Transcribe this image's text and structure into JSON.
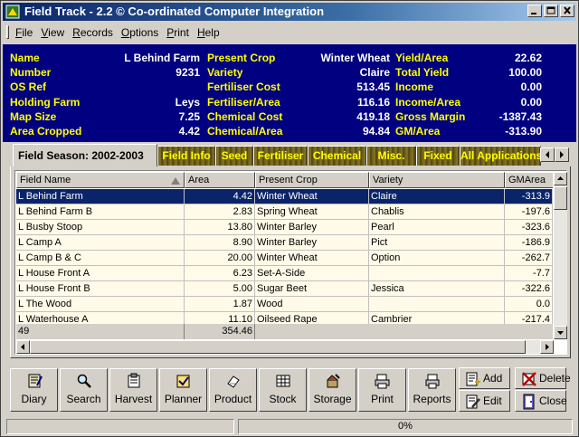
{
  "window": {
    "title": "Field Track - 2.2 © Co-ordinated Computer Integration"
  },
  "menu": {
    "items": [
      {
        "label": "File",
        "underline": "F",
        "rest": "ile"
      },
      {
        "label": "View",
        "underline": "V",
        "rest": "iew"
      },
      {
        "label": "Records",
        "underline": "R",
        "rest": "ecords"
      },
      {
        "label": "Options",
        "underline": "O",
        "rest": "ptions"
      },
      {
        "label": "Print",
        "underline": "P",
        "rest": "rint"
      },
      {
        "label": "Help",
        "underline": "H",
        "rest": "elp"
      }
    ]
  },
  "info": {
    "col1": [
      {
        "label": "Name",
        "value": "L Behind Farm"
      },
      {
        "label": "Number",
        "value": "9231"
      },
      {
        "label": "OS Ref",
        "value": ""
      },
      {
        "label": "Holding Farm",
        "value": "Leys"
      },
      {
        "label": "Map Size",
        "value": "7.25"
      },
      {
        "label": "Area Cropped",
        "value": "4.42"
      }
    ],
    "col2": [
      {
        "label": "Present Crop",
        "value": "Winter Wheat"
      },
      {
        "label": "Variety",
        "value": "Claire"
      },
      {
        "label": "Fertiliser Cost",
        "value": "513.45"
      },
      {
        "label": "Fertiliser/Area",
        "value": "116.16"
      },
      {
        "label": "Chemical Cost",
        "value": "419.18"
      },
      {
        "label": "Chemical/Area",
        "value": "94.84"
      }
    ],
    "col3": [
      {
        "label": "Yield/Area",
        "value": "22.62"
      },
      {
        "label": "Total Yield",
        "value": "100.00"
      },
      {
        "label": "Income",
        "value": "0.00"
      },
      {
        "label": "Income/Area",
        "value": "0.00"
      },
      {
        "label": "Gross Margin",
        "value": "-1387.43"
      },
      {
        "label": "GM/Area",
        "value": "-313.90"
      }
    ]
  },
  "tabs": {
    "active": "Field Season: 2002-2003",
    "others": [
      "Field Info",
      "Seed",
      "Fertiliser",
      "Chemical",
      "Misc.",
      "Fixed",
      "All Applications"
    ]
  },
  "grid": {
    "headers": [
      "Field Name",
      "Area",
      "Present Crop",
      "Variety",
      "GMArea"
    ],
    "rows": [
      {
        "name": "L Behind Farm",
        "area": "4.42",
        "crop": "Winter Wheat",
        "variety": "Claire",
        "gm": "-313.9",
        "selected": true
      },
      {
        "name": "L Behind Farm B",
        "area": "2.83",
        "crop": "Spring Wheat",
        "variety": "Chablis",
        "gm": "-197.6"
      },
      {
        "name": "L Busby Stoop",
        "area": "13.80",
        "crop": "Winter Barley",
        "variety": "Pearl",
        "gm": "-323.6"
      },
      {
        "name": "L Camp A",
        "area": "8.90",
        "crop": "Winter Barley",
        "variety": "Pict",
        "gm": "-186.9"
      },
      {
        "name": "L Camp B & C",
        "area": "20.00",
        "crop": "Winter Wheat",
        "variety": "Option",
        "gm": "-262.7"
      },
      {
        "name": "L House Front A",
        "area": "6.23",
        "crop": "Set-A-Side",
        "variety": "",
        "gm": "-7.7"
      },
      {
        "name": "L House Front B",
        "area": "5.00",
        "crop": "Sugar Beet",
        "variety": "Jessica",
        "gm": "-322.6"
      },
      {
        "name": "L The Wood",
        "area": "1.87",
        "crop": "Wood",
        "variety": "",
        "gm": "0.0"
      },
      {
        "name": "L Waterhouse A",
        "area": "11.10",
        "crop": "Oilseed Rape",
        "variety": "Cambrier",
        "gm": "-217.4"
      }
    ],
    "totals": {
      "count": "49",
      "area": "354.46"
    }
  },
  "toolbar": {
    "buttons": [
      {
        "label": "Diary",
        "icon": "diary-icon"
      },
      {
        "label": "Search",
        "icon": "search-icon"
      },
      {
        "label": "Harvest",
        "icon": "harvest-icon"
      },
      {
        "label": "Planner",
        "icon": "planner-icon"
      },
      {
        "label": "Product",
        "icon": "product-icon"
      },
      {
        "label": "Stock",
        "icon": "stock-icon"
      },
      {
        "label": "Storage",
        "icon": "storage-icon"
      },
      {
        "label": "Print",
        "icon": "print-icon"
      },
      {
        "label": "Reports",
        "icon": "reports-icon"
      }
    ],
    "add": "Add",
    "delete": "Delete",
    "edit": "Edit",
    "close": "Close"
  },
  "status": {
    "progress": "0%"
  },
  "colors": {
    "info_bg": "#000080",
    "label": "#ffff00",
    "value": "#ffffff",
    "selection": "#0a246a"
  }
}
